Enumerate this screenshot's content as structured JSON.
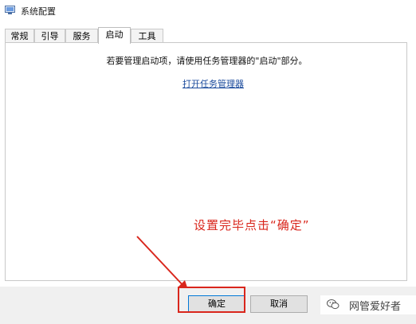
{
  "window": {
    "title": "系统配置",
    "icon": "system-config-icon"
  },
  "tabs": [
    {
      "label": "常规",
      "active": false
    },
    {
      "label": "引导",
      "active": false
    },
    {
      "label": "服务",
      "active": false
    },
    {
      "label": "启动",
      "active": true
    },
    {
      "label": "工具",
      "active": false
    }
  ],
  "startup_panel": {
    "info_text": "若要管理启动项，请使用任务管理器的\"启动\"部分。",
    "task_manager_link": "打开任务管理器"
  },
  "annotation": {
    "text": "设置完毕点击“确定”",
    "color": "#d9261c"
  },
  "buttons": {
    "ok_label": "确定",
    "cancel_label": "取消"
  },
  "watermark": {
    "text": "网管爱好者",
    "icon": "wechat-icon"
  }
}
